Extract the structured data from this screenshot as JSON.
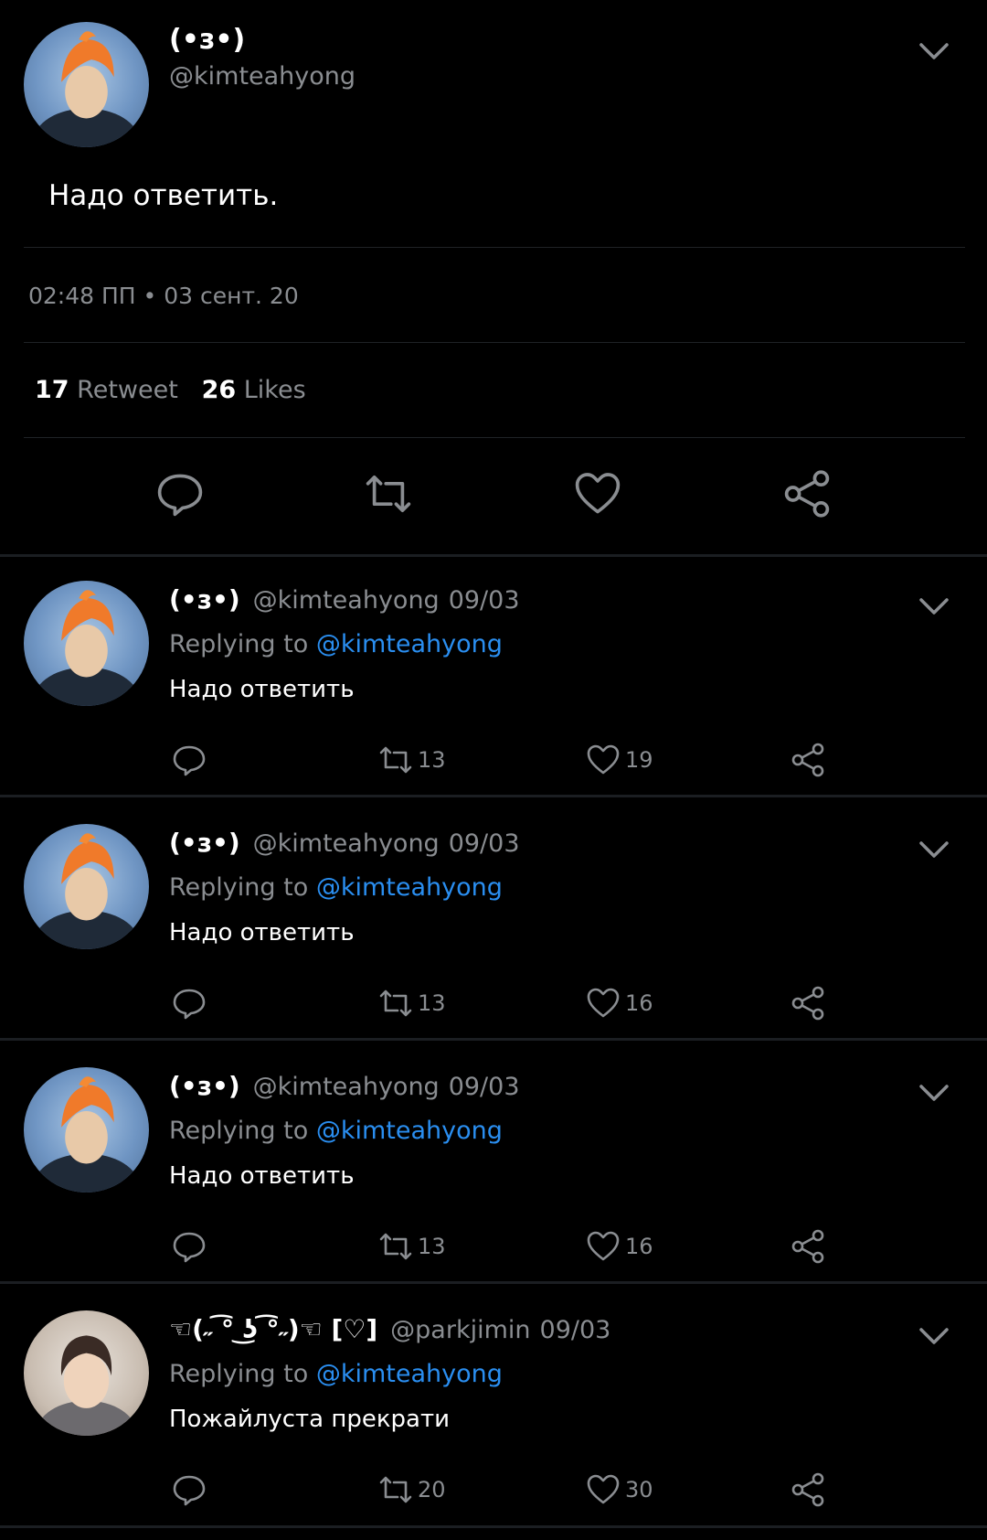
{
  "main_tweet": {
    "name": "(•з•)",
    "handle": "@kimteahyong",
    "text": "Надо ответить.",
    "timestamp": "02:48 ПП • 03 сент. 20",
    "retweets_count": "17",
    "retweets_label": "Retweet",
    "likes_count": "26",
    "likes_label": "Likes"
  },
  "replies": [
    {
      "name": "(•з•)",
      "handle": "@kimteahyong",
      "date": "09/03",
      "replying_label": "Replying to",
      "replying_to": "@kimteahyong",
      "text": "Надо ответить",
      "retweets": "13",
      "likes": "19"
    },
    {
      "name": "(•з•)",
      "handle": "@kimteahyong",
      "date": "09/03",
      "replying_label": "Replying to",
      "replying_to": "@kimteahyong",
      "text": "Надо ответить",
      "retweets": "13",
      "likes": "16"
    },
    {
      "name": "(•з•)",
      "handle": "@kimteahyong",
      "date": "09/03",
      "replying_label": "Replying to",
      "replying_to": "@kimteahyong",
      "text": "Надо ответить",
      "retweets": "13",
      "likes": "16"
    },
    {
      "name": "☜(˶ ͡° ͜ʖ ͡°˶)☜ [♡]",
      "handle": "@parkjimin",
      "date": "09/03",
      "replying_label": "Replying to",
      "replying_to": "@kimteahyong",
      "text": "Пожайлуста прекрати",
      "retweets": "20",
      "likes": "30"
    }
  ],
  "icons": {
    "reply": "speech-bubble-icon",
    "retweet": "retweet-icon",
    "like": "heart-icon",
    "share": "share-icon",
    "menu": "chevron-down-icon"
  },
  "colors": {
    "background": "#000000",
    "muted_text": "#8a8d91",
    "link": "#2a8ef0",
    "divider": "#1f2226"
  }
}
